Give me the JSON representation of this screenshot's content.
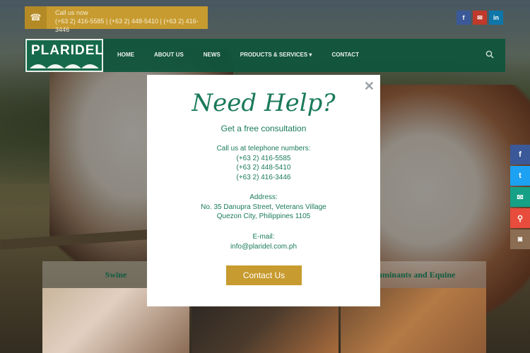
{
  "topbar": {
    "call_label": "Call us now",
    "call_numbers": "(+63 2) 416-5585 | (+63 2) 448-5410 | (+63 2) 416-3446",
    "social": [
      {
        "icon": "facebook-icon",
        "glyph": "f",
        "color": "#3b5998"
      },
      {
        "icon": "mail-icon",
        "glyph": "✉",
        "color": "#c0392b"
      },
      {
        "icon": "linkedin-icon",
        "glyph": "in",
        "color": "#0e76a8"
      }
    ]
  },
  "nav": {
    "logo_text": "PLARIDEL",
    "items": [
      "HOME",
      "ABOUT US",
      "NEWS",
      "PRODUCTS & SERVICES ▾",
      "CONTACT"
    ]
  },
  "cards": [
    {
      "title": "Swine"
    },
    {
      "title": ""
    },
    {
      "title": "Ruminants and Equine"
    }
  ],
  "side_social": [
    {
      "icon": "facebook-icon",
      "glyph": "f",
      "color": "#3b5998"
    },
    {
      "icon": "twitter-icon",
      "glyph": "t",
      "color": "#1da1f2"
    },
    {
      "icon": "mail-icon",
      "glyph": "✉",
      "color": "#16a085"
    },
    {
      "icon": "location-icon",
      "glyph": "⚲",
      "color": "#e74c3c"
    },
    {
      "icon": "instagram-icon",
      "glyph": "◙",
      "color": "#8a6d52"
    }
  ],
  "modal": {
    "title": "Need Help?",
    "subtitle": "Get a free consultation",
    "phone_heading": "Call us at telephone numbers:",
    "phone1": "(+63 2) 416-5585",
    "phone2": "(+63 2) 448-5410",
    "phone3": "(+63 2) 416-3446",
    "address_heading": "Address:",
    "address1": "No. 35 Danupra Street, Veterans Village",
    "address2": "Quezon City, Philippines 1105",
    "email_heading": "E-mail:",
    "email": "info@plaridel.com.ph",
    "cta_label": "Contact Us",
    "close_glyph": "✕"
  }
}
